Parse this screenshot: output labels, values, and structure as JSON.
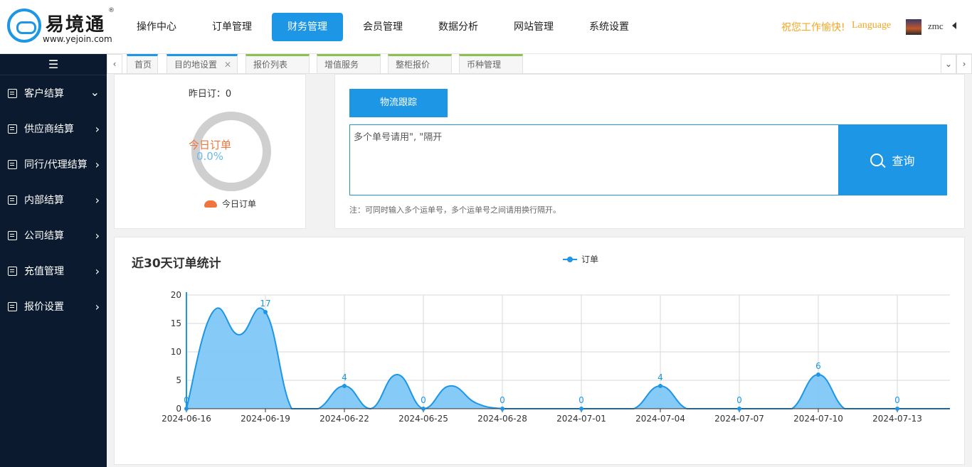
{
  "brand": {
    "name": "易境通",
    "reg": "®",
    "url": "www.yejoin.com"
  },
  "topnav": [
    "操作中心",
    "订单管理",
    "财务管理",
    "会员管理",
    "数据分析",
    "网站管理",
    "系统设置"
  ],
  "topnav_active": "财务管理",
  "header": {
    "greeting": "祝您工作愉快!",
    "language": "Language",
    "username": "zmc"
  },
  "sidebar": {
    "items": [
      {
        "label": "客户结算",
        "arrow": "⌄"
      },
      {
        "label": "供应商结算",
        "arrow": "›"
      },
      {
        "label": "同行/代理结算",
        "arrow": "›"
      },
      {
        "label": "内部结算",
        "arrow": "›"
      },
      {
        "label": "公司结算",
        "arrow": "›"
      },
      {
        "label": "充值管理",
        "arrow": "›"
      },
      {
        "label": "报价设置",
        "arrow": "›"
      }
    ]
  },
  "tabs": [
    {
      "label": "首页",
      "color": "blue"
    },
    {
      "label": "目的地设置",
      "color": "blue",
      "close": "✕"
    },
    {
      "label": "报价列表",
      "color": "green"
    },
    {
      "label": "增值服务",
      "color": "green"
    },
    {
      "label": "整柜报价",
      "color": "green"
    },
    {
      "label": "币种管理",
      "color": "green"
    }
  ],
  "orders_card": {
    "yesterday": "昨日订：0",
    "today_label": "今日订单",
    "today_value": "0.0%",
    "legend": "今日订单"
  },
  "tracking": {
    "button": "物流跟踪",
    "placeholder": "多个单号请用\", \"隔开",
    "query": "查询",
    "note": "注：可同时输入多个运单号，多个运单号之间请用换行隔开。"
  },
  "chart_title": "近30天订单统计",
  "chart_data": {
    "type": "area",
    "title": "近30天订单统计",
    "series": [
      {
        "name": "订单",
        "x": [
          "2024-06-16",
          "2024-06-17",
          "2024-06-18",
          "2024-06-19",
          "2024-06-20",
          "2024-06-21",
          "2024-06-22",
          "2024-06-23",
          "2024-06-24",
          "2024-06-25",
          "2024-06-26",
          "2024-06-27",
          "2024-06-28",
          "2024-06-29",
          "2024-06-30",
          "2024-07-01",
          "2024-07-02",
          "2024-07-03",
          "2024-07-04",
          "2024-07-05",
          "2024-07-06",
          "2024-07-07",
          "2024-07-08",
          "2024-07-09",
          "2024-07-10",
          "2024-07-11",
          "2024-07-12",
          "2024-07-13",
          "2024-07-14",
          "2024-07-15"
        ],
        "values": [
          0,
          17,
          13,
          17,
          0,
          0,
          4,
          0,
          6,
          0,
          4,
          1,
          0,
          0,
          0,
          0,
          0,
          0,
          4,
          0,
          0,
          0,
          0,
          0,
          6,
          0,
          0,
          0,
          0,
          0
        ]
      }
    ],
    "x_tick_labels": [
      "2024-06-16",
      "2024-06-19",
      "2024-06-22",
      "2024-06-25",
      "2024-06-28",
      "2024-07-01",
      "2024-07-04",
      "2024-07-07",
      "2024-07-10",
      "2024-07-13"
    ],
    "data_labels": [
      0,
      17,
      4,
      0,
      0,
      0,
      4,
      0,
      6,
      0
    ],
    "ylim": [
      0,
      20
    ],
    "yticks": [
      0,
      5,
      10,
      15,
      20
    ],
    "grid": true,
    "legend_position": "top-center",
    "colors": {
      "line": "#1e96e6",
      "fill": "#80c8f8"
    }
  }
}
